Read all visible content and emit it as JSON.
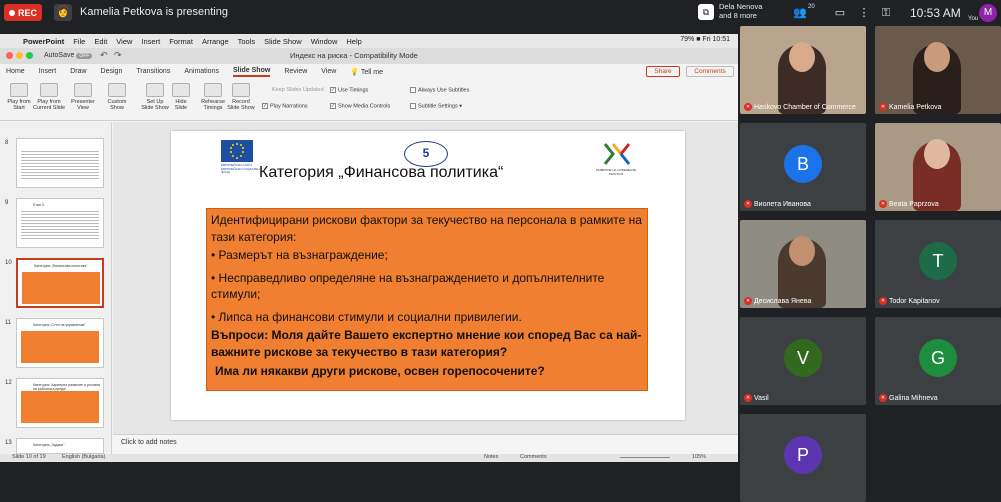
{
  "meet": {
    "rec_label": "REC",
    "presenting_text": "Kamelia Petkova is presenting",
    "host_name_line1": "Dela Nenova",
    "host_name_line2": "and 8 more",
    "people_count": "20",
    "clock": "10:53 AM",
    "me_initial": "M",
    "you_label": "You"
  },
  "mac": {
    "menu": [
      "PowerPoint",
      "File",
      "Edit",
      "View",
      "Insert",
      "Format",
      "Arrange",
      "Tools",
      "Slide Show",
      "Window",
      "Help"
    ],
    "status": "79% ■  Fri 10:51"
  },
  "ppt": {
    "autosave": "AutoSave",
    "autosave_state": "OFF",
    "doc_title": "Индекс на риска - Compatibility Mode",
    "tabs": [
      "Home",
      "Insert",
      "Draw",
      "Design",
      "Transitions",
      "Animations",
      "Slide Show",
      "Review",
      "View"
    ],
    "tell_me": "Tell me",
    "share": "Share",
    "comments": "Comments",
    "tools": [
      {
        "l1": "Play from",
        "l2": "Start"
      },
      {
        "l1": "Play from",
        "l2": "Current Slide"
      },
      {
        "l1": "Presenter",
        "l2": "View"
      },
      {
        "l1": "Custom",
        "l2": "Show"
      },
      {
        "l1": "Set Up",
        "l2": "Slide Show"
      },
      {
        "l1": "Hide",
        "l2": "Slide"
      },
      {
        "l1": "Rehearse",
        "l2": "Timings"
      },
      {
        "l1": "Record",
        "l2": "Slide Show"
      }
    ],
    "checks": {
      "keep_updated": "Keep Slides Updated",
      "use_timings": "Use Timings",
      "play_narrations": "Play Narrations",
      "show_media": "Show Media Controls",
      "always_subtitles": "Always Use Subtitles",
      "subtitle_settings": "Subtitle Settings"
    },
    "thumb_numbers": [
      "8",
      "9",
      "10",
      "11",
      "12",
      "13"
    ],
    "thumb_titles": [
      "",
      "Етап 3.",
      "Категория „Финансова политика“",
      "Категория „Стил на управление“",
      "Категория „Кариерно развитие и условия на работната среда“",
      "Категория „Задачи“"
    ],
    "notes_placeholder": "Click to add notes",
    "status": {
      "slide": "Slide 10 of 19",
      "lang": "English (Bulgaria)",
      "notes": "Notes",
      "comments": "Comments",
      "zoom": "105%"
    }
  },
  "slide": {
    "eu_caption": "ЕВРОПЕЙСКИ СЪЮЗ ЕВРОПЕЙСКИ СОЦИАЛЕН ФОНД",
    "emblem_text": "5",
    "right_caption": "РАЗВИТИЕ НА ЧОВЕШКИТЕ РЕСУРСИ",
    "title": "Категория „Финансова политика“",
    "intro": "Идентифицирани рискови фактори за текучество на персонала в рамките на тази категория:",
    "bullets": [
      "• Размерът на възнаграждение;",
      "• Несправедливо определяне на възнаграждението и допълнителните стимули;",
      "• Липса на финансови стимули и социални привилегии."
    ],
    "question": "Въпроси: Моля дайте Вашето експертно мнение кои според Вас са най-важните рискове за текучество в тази категория?",
    "question2": "Има ли някакви други рискове, освен горепосочените?"
  },
  "participants": [
    {
      "name": "Haskovo Chamber of Commerce",
      "type": "video",
      "bg": "#b9a48e",
      "skin": "#d9a98c",
      "cloth": "#3d2b25"
    },
    {
      "name": "Kamelia Petkova",
      "type": "video",
      "bg": "#6a5a4c",
      "skin": "#c99a7c",
      "cloth": "#2a1f1a"
    },
    {
      "name": "Виолета Иванова",
      "type": "avatar",
      "initial": "B",
      "color": "#1a73e8"
    },
    {
      "name": "Beata Paprzova",
      "type": "video",
      "bg": "#a89a84",
      "skin": "#e0b8a0",
      "cloth": "#7a2d25"
    },
    {
      "name": "Десислава Янева",
      "type": "video",
      "bg": "#8e8c83",
      "skin": "#c19070",
      "cloth": "#4a3a30"
    },
    {
      "name": "Todor Kapitanov",
      "type": "avatar",
      "initial": "T",
      "color": "#1e6b4a"
    },
    {
      "name": "Vasil",
      "type": "avatar",
      "initial": "V",
      "color": "#33691e"
    },
    {
      "name": "Galina Mihneva",
      "type": "avatar",
      "initial": "G",
      "color": "#1e8e3e"
    },
    {
      "name": "",
      "type": "avatar",
      "initial": "P",
      "color": "#5e35b1"
    }
  ],
  "colors": {
    "accent": "#c43e1c",
    "slide_box": "#f07f31",
    "meet_bg": "#202124"
  }
}
